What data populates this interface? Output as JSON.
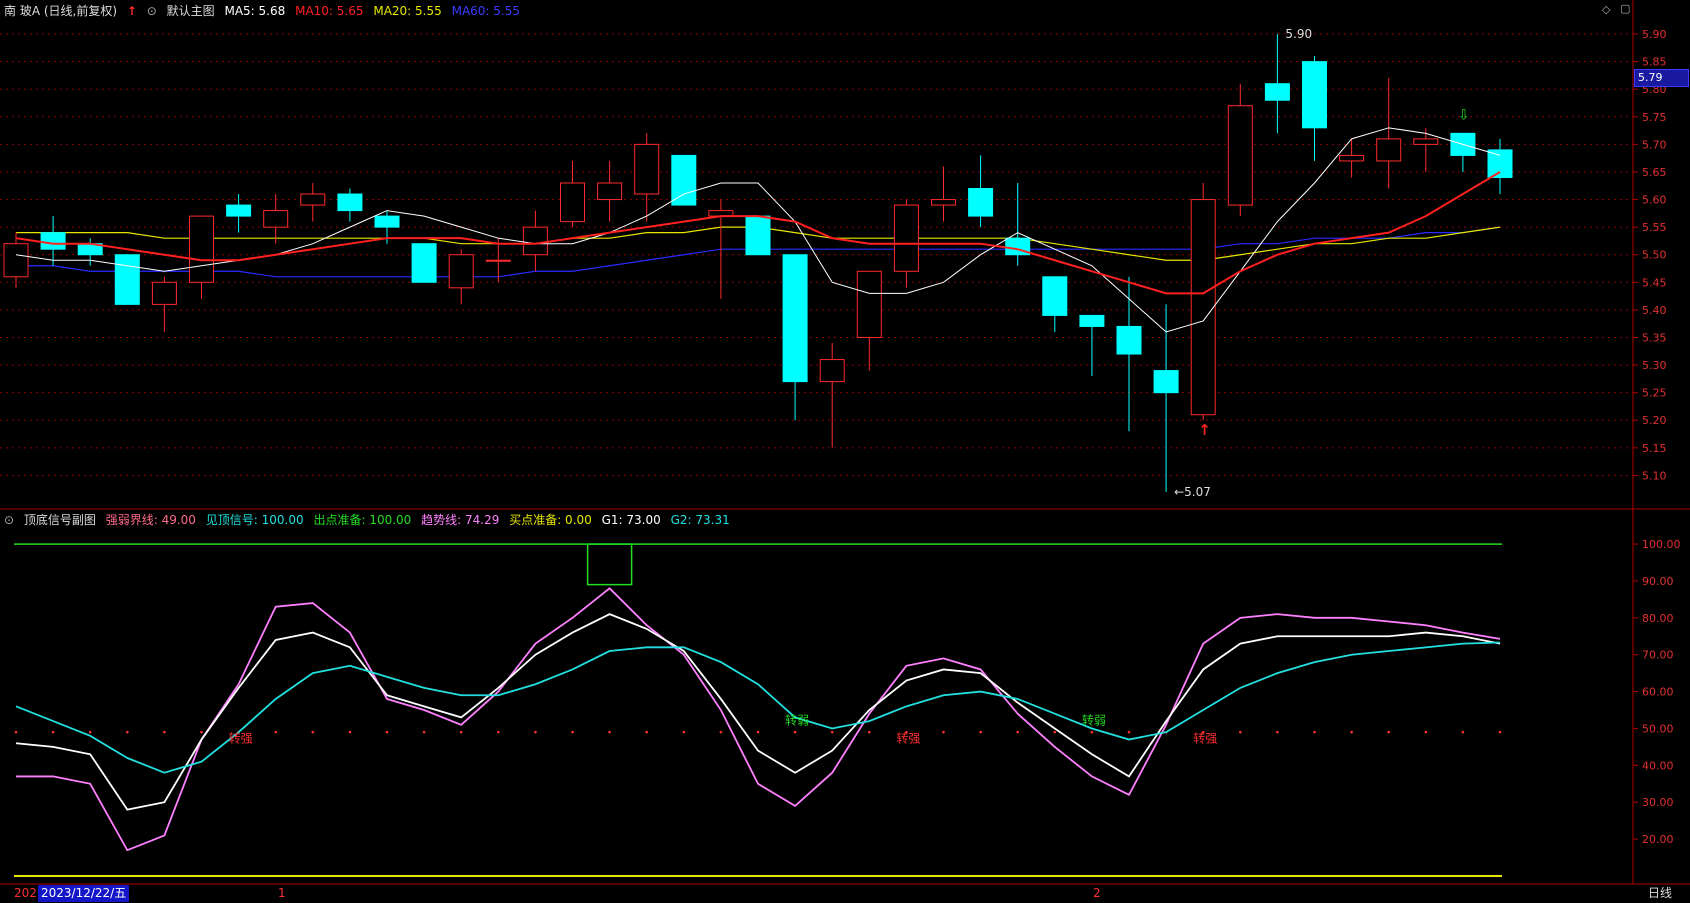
{
  "main_header": {
    "symbol": "南 玻A (日线,前复权)",
    "chart_name": "默认主图",
    "ma5": "MA5: 5.68",
    "ma10": "MA10: 5.65",
    "ma20": "MA20: 5.55",
    "ma60": "MA60: 5.55"
  },
  "sub_header": {
    "name": "顶底信号副图",
    "qrjx": "强弱界线: 49.00",
    "jdxh": "见顶信号: 100.00",
    "cdzb": "出点准备: 100.00",
    "qsx": "趋势线: 74.29",
    "mdzb": "买点准备: 0.00",
    "g1": "G1: 73.00",
    "g2": "G2: 73.31"
  },
  "current_price_label": "5.79",
  "bottom_bar": {
    "year_fragment": "202",
    "cursor_date": "2023/12/22/五",
    "month_1": "1",
    "month_2": "2",
    "period": "日线"
  },
  "colors": {
    "up": "#ff2a2a",
    "down": "#00ffff",
    "ma5": "#ffffff",
    "ma10": "#ff2020",
    "ma20": "#e6e600",
    "ma60": "#2a2aff",
    "qsx": "#ff80ff",
    "g1": "#ffffff",
    "g2": "#22e0e0",
    "grid": "#8b0000"
  },
  "chart_data": [
    {
      "type": "candlestick",
      "title": "南 玻A (日线,前复权)",
      "ylim": [
        5.05,
        5.92
      ],
      "y_ticks": [
        "5.90",
        "5.85",
        "5.80",
        "5.75",
        "5.70",
        "5.65",
        "5.60",
        "5.55",
        "5.50",
        "5.45",
        "5.40",
        "5.35",
        "5.30",
        "5.25",
        "5.20",
        "5.15",
        "5.10"
      ],
      "candles": [
        {
          "o": 5.46,
          "h": 5.54,
          "l": 5.44,
          "c": 5.52
        },
        {
          "o": 5.54,
          "h": 5.57,
          "l": 5.48,
          "c": 5.51
        },
        {
          "o": 5.52,
          "h": 5.53,
          "l": 5.48,
          "c": 5.5
        },
        {
          "o": 5.5,
          "h": 5.5,
          "l": 5.41,
          "c": 5.41
        },
        {
          "o": 5.41,
          "h": 5.46,
          "l": 5.36,
          "c": 5.45
        },
        {
          "o": 5.45,
          "h": 5.57,
          "l": 5.42,
          "c": 5.57
        },
        {
          "o": 5.59,
          "h": 5.61,
          "l": 5.54,
          "c": 5.57
        },
        {
          "o": 5.55,
          "h": 5.61,
          "l": 5.52,
          "c": 5.58
        },
        {
          "o": 5.59,
          "h": 5.63,
          "l": 5.56,
          "c": 5.61
        },
        {
          "o": 5.61,
          "h": 5.62,
          "l": 5.56,
          "c": 5.58
        },
        {
          "o": 5.57,
          "h": 5.58,
          "l": 5.52,
          "c": 5.55
        },
        {
          "o": 5.52,
          "h": 5.52,
          "l": 5.45,
          "c": 5.45
        },
        {
          "o": 5.44,
          "h": 5.51,
          "l": 5.41,
          "c": 5.5
        },
        {
          "o": 5.49,
          "h": 5.53,
          "l": 5.45,
          "c": 5.49
        },
        {
          "o": 5.5,
          "h": 5.58,
          "l": 5.47,
          "c": 5.55
        },
        {
          "o": 5.56,
          "h": 5.67,
          "l": 5.55,
          "c": 5.63
        },
        {
          "o": 5.6,
          "h": 5.67,
          "l": 5.56,
          "c": 5.63
        },
        {
          "o": 5.61,
          "h": 5.72,
          "l": 5.56,
          "c": 5.7
        },
        {
          "o": 5.68,
          "h": 5.68,
          "l": 5.59,
          "c": 5.59
        },
        {
          "o": 5.57,
          "h": 5.6,
          "l": 5.42,
          "c": 5.58
        },
        {
          "o": 5.57,
          "h": 5.57,
          "l": 5.5,
          "c": 5.5
        },
        {
          "o": 5.5,
          "h": 5.5,
          "l": 5.2,
          "c": 5.27
        },
        {
          "o": 5.27,
          "h": 5.34,
          "l": 5.15,
          "c": 5.31
        },
        {
          "o": 5.35,
          "h": 5.47,
          "l": 5.29,
          "c": 5.47
        },
        {
          "o": 5.47,
          "h": 5.6,
          "l": 5.44,
          "c": 5.59
        },
        {
          "o": 5.59,
          "h": 5.66,
          "l": 5.56,
          "c": 5.6
        },
        {
          "o": 5.62,
          "h": 5.68,
          "l": 5.55,
          "c": 5.57
        },
        {
          "o": 5.53,
          "h": 5.63,
          "l": 5.48,
          "c": 5.5
        },
        {
          "o": 5.46,
          "h": 5.46,
          "l": 5.36,
          "c": 5.39
        },
        {
          "o": 5.39,
          "h": 5.39,
          "l": 5.28,
          "c": 5.37
        },
        {
          "o": 5.37,
          "h": 5.46,
          "l": 5.18,
          "c": 5.32
        },
        {
          "o": 5.29,
          "h": 5.41,
          "l": 5.07,
          "c": 5.25
        },
        {
          "o": 5.21,
          "h": 5.63,
          "l": 5.2,
          "c": 5.6
        },
        {
          "o": 5.59,
          "h": 5.81,
          "l": 5.57,
          "c": 5.77
        },
        {
          "o": 5.81,
          "h": 5.9,
          "l": 5.72,
          "c": 5.78
        },
        {
          "o": 5.85,
          "h": 5.86,
          "l": 5.67,
          "c": 5.73
        },
        {
          "o": 5.67,
          "h": 5.71,
          "l": 5.64,
          "c": 5.68
        },
        {
          "o": 5.67,
          "h": 5.82,
          "l": 5.62,
          "c": 5.71
        },
        {
          "o": 5.7,
          "h": 5.73,
          "l": 5.65,
          "c": 5.71
        },
        {
          "o": 5.72,
          "h": 5.72,
          "l": 5.65,
          "c": 5.68
        },
        {
          "o": 5.69,
          "h": 5.71,
          "l": 5.61,
          "c": 5.64
        }
      ],
      "ma5": [
        5.5,
        5.49,
        5.49,
        5.48,
        5.47,
        5.48,
        5.49,
        5.5,
        5.52,
        5.55,
        5.58,
        5.57,
        5.55,
        5.53,
        5.52,
        5.52,
        5.54,
        5.57,
        5.61,
        5.63,
        5.63,
        5.56,
        5.45,
        5.43,
        5.43,
        5.45,
        5.5,
        5.54,
        5.51,
        5.48,
        5.42,
        5.36,
        5.38,
        5.47,
        5.56,
        5.63,
        5.71,
        5.73,
        5.72,
        5.7,
        5.68
      ],
      "ma10": [
        5.53,
        5.52,
        5.52,
        5.51,
        5.5,
        5.49,
        5.49,
        5.5,
        5.51,
        5.52,
        5.53,
        5.53,
        5.53,
        5.52,
        5.52,
        5.53,
        5.54,
        5.55,
        5.56,
        5.57,
        5.57,
        5.56,
        5.53,
        5.52,
        5.52,
        5.52,
        5.52,
        5.51,
        5.49,
        5.47,
        5.45,
        5.43,
        5.43,
        5.47,
        5.5,
        5.52,
        5.53,
        5.54,
        5.57,
        5.61,
        5.65
      ],
      "ma20": [
        5.54,
        5.54,
        5.54,
        5.54,
        5.53,
        5.53,
        5.53,
        5.53,
        5.53,
        5.53,
        5.53,
        5.53,
        5.52,
        5.52,
        5.52,
        5.53,
        5.53,
        5.54,
        5.54,
        5.55,
        5.55,
        5.54,
        5.53,
        5.53,
        5.53,
        5.53,
        5.53,
        5.53,
        5.52,
        5.51,
        5.5,
        5.49,
        5.49,
        5.5,
        5.51,
        5.52,
        5.52,
        5.53,
        5.53,
        5.54,
        5.55
      ],
      "ma60": [
        5.48,
        5.48,
        5.47,
        5.47,
        5.47,
        5.47,
        5.47,
        5.46,
        5.46,
        5.46,
        5.46,
        5.46,
        5.46,
        5.46,
        5.47,
        5.47,
        5.48,
        5.49,
        5.5,
        5.51,
        5.51,
        5.51,
        5.51,
        5.51,
        5.51,
        5.51,
        5.51,
        5.51,
        5.51,
        5.51,
        5.51,
        5.51,
        5.51,
        5.52,
        5.52,
        5.53,
        5.53,
        5.53,
        5.54,
        5.54,
        5.55
      ],
      "annotations": [
        {
          "label": "5.90",
          "index": 34,
          "value": 5.9
        },
        {
          "label": "5.07",
          "index": 31,
          "value": 5.07
        }
      ],
      "buy_arrow_index": 32,
      "sell_arrow_index": 39
    },
    {
      "type": "line",
      "title": "顶底信号副图",
      "ylim": [
        10,
        103
      ],
      "y_ticks": [
        "100.00",
        "90.00",
        "80.00",
        "70.00",
        "60.00",
        "50.00",
        "40.00",
        "30.00",
        "20.00"
      ],
      "x_index": [
        0,
        1,
        2,
        3,
        4,
        5,
        6,
        7,
        8,
        9,
        10,
        11,
        12,
        13,
        14,
        15,
        16,
        17,
        18,
        19,
        20,
        21,
        22,
        23,
        24,
        25,
        26,
        27,
        28,
        29,
        30,
        31,
        32,
        33,
        34,
        35,
        36,
        37,
        38,
        39,
        40
      ],
      "series": [
        {
          "name": "趋势线",
          "values": [
            37,
            37,
            35,
            17,
            21,
            47,
            62,
            83,
            84,
            76,
            58,
            55,
            51,
            60,
            73,
            80,
            88,
            78,
            70,
            55,
            35,
            29,
            38,
            54,
            67,
            69,
            66,
            54,
            45,
            37,
            32,
            51,
            73,
            80,
            81,
            80,
            80,
            79,
            78,
            76,
            74.29
          ]
        },
        {
          "name": "G1",
          "values": [
            46,
            45,
            43,
            28,
            30,
            47,
            61,
            74,
            76,
            72,
            59,
            56,
            53,
            61,
            70,
            76,
            81,
            77,
            71,
            58,
            44,
            38,
            44,
            55,
            63,
            66,
            65,
            57,
            50,
            43,
            37,
            52,
            66,
            73,
            75,
            75,
            75,
            75,
            76,
            75,
            73
          ]
        },
        {
          "name": "G2",
          "values": [
            56,
            52,
            48,
            42,
            38,
            41,
            49,
            58,
            65,
            67,
            64,
            61,
            59,
            59,
            62,
            66,
            71,
            72,
            72,
            68,
            62,
            53,
            50,
            52,
            56,
            59,
            60,
            58,
            54,
            50,
            47,
            49,
            55,
            61,
            65,
            68,
            70,
            71,
            72,
            73,
            73.31
          ]
        }
      ],
      "threshold": 49,
      "top_line": 100,
      "bottom_line": 10,
      "signals": [
        {
          "label": "转强",
          "index": 6,
          "color": "#ff3030"
        },
        {
          "label": "转弱",
          "index": 21,
          "color": "#22dd22"
        },
        {
          "label": "转强",
          "index": 24,
          "color": "#ff3030"
        },
        {
          "label": "转弱",
          "index": 29,
          "color": "#22dd22"
        },
        {
          "label": "转强",
          "index": 32,
          "color": "#ff3030"
        }
      ],
      "top_box": {
        "start_index": 16,
        "end_index": 17,
        "from": 89,
        "to": 100
      }
    }
  ]
}
